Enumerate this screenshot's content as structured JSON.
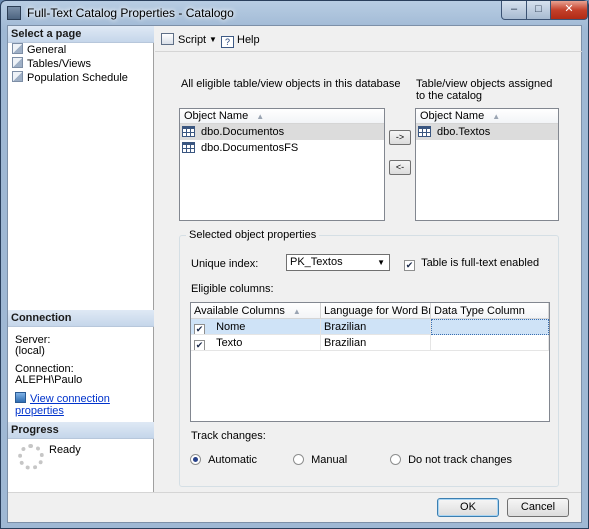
{
  "window": {
    "title": "Full-Text Catalog Properties - Catalogo",
    "minimize": "–",
    "maximize": "□",
    "close": "✕"
  },
  "left": {
    "select_page_header": "Select a page",
    "pages": [
      {
        "label": "General",
        "icon": "page-icon"
      },
      {
        "label": "Tables/Views",
        "icon": "page-icon"
      },
      {
        "label": "Population Schedule",
        "icon": "page-icon"
      }
    ],
    "connection_header": "Connection",
    "server_label": "Server:",
    "server_value": "(local)",
    "connection_label": "Connection:",
    "connection_value": "ALEPH\\Paulo",
    "view_connection_link": "View connection properties",
    "progress_header": "Progress",
    "progress_status": "Ready"
  },
  "toolbar": {
    "script_label": "Script",
    "script_dropdown": "▼",
    "help_label": "Help"
  },
  "main": {
    "eligible_label": "All eligible table/view objects in this database",
    "assigned_label": "Table/view objects assigned to the catalog",
    "object_name_header": "Object Name",
    "sort_glyph": "▲",
    "eligible_objects": [
      "dbo.Documentos",
      "dbo.DocumentosFS"
    ],
    "assigned_objects": [
      "dbo.Textos"
    ],
    "move_right": "->",
    "move_left": "<-",
    "selected_props_title": "Selected object properties",
    "unique_index_label": "Unique index:",
    "unique_index_value": "PK_Textos",
    "fulltext_enabled_label": "Table is full-text enabled",
    "fulltext_enabled": true,
    "eligible_columns_label": "Eligible columns:",
    "columns_headers": [
      "Available Columns",
      "Language for Word Bre...",
      "Data Type Column"
    ],
    "columns_rows": [
      {
        "checked": true,
        "name": "Nome",
        "language": "Brazilian",
        "data_type": ""
      },
      {
        "checked": true,
        "name": "Texto",
        "language": "Brazilian",
        "data_type": ""
      }
    ],
    "track_changes_label": "Track changes:",
    "track_options": [
      {
        "label": "Automatic",
        "selected": true
      },
      {
        "label": "Manual",
        "selected": false
      },
      {
        "label": "Do not track changes",
        "selected": false
      }
    ]
  },
  "buttons": {
    "ok": "OK",
    "cancel": "Cancel"
  },
  "colors": {
    "selection": "#cfe3f7",
    "link": "#0033cc"
  }
}
